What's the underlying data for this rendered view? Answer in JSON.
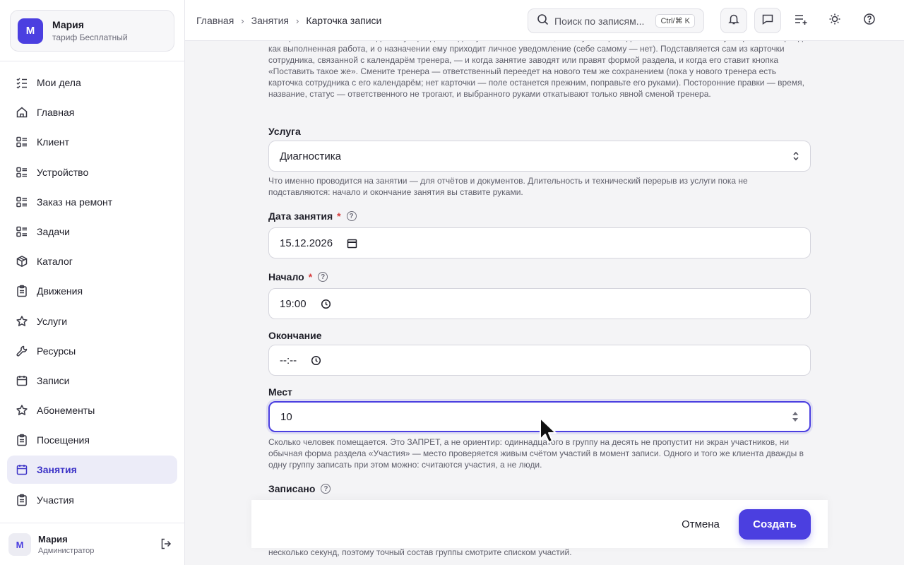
{
  "org": {
    "avatar": "М",
    "name": "Мария",
    "plan": "тариф Бесплатный"
  },
  "nav": [
    {
      "label": "Мои дела",
      "icon": "checklist-icon"
    },
    {
      "label": "Главная",
      "icon": "home-icon"
    },
    {
      "label": "Клиент",
      "icon": "list-icon"
    },
    {
      "label": "Устройство",
      "icon": "list-icon"
    },
    {
      "label": "Заказ на ремонт",
      "icon": "list-icon"
    },
    {
      "label": "Задачи",
      "icon": "list-icon"
    },
    {
      "label": "Каталог",
      "icon": "box-icon"
    },
    {
      "label": "Движения",
      "icon": "clipboard-icon"
    },
    {
      "label": "Услуги",
      "icon": "star-icon"
    },
    {
      "label": "Ресурсы",
      "icon": "wrench-icon"
    },
    {
      "label": "Записи",
      "icon": "calendar-icon"
    },
    {
      "label": "Абонементы",
      "icon": "star-icon"
    },
    {
      "label": "Посещения",
      "icon": "clipboard-icon"
    },
    {
      "label": "Занятия",
      "icon": "calendar-icon",
      "active": true
    },
    {
      "label": "Участия",
      "icon": "clipboard-icon"
    }
  ],
  "user": {
    "avatar": "М",
    "name": "Мария",
    "role": "Администратор"
  },
  "breadcrumb": {
    "home": "Главная",
    "section": "Занятия",
    "current": "Карточка записи"
  },
  "search": {
    "placeholder": "Поиск по записям...",
    "shortcut": "Ctrl/⌘ K"
  },
  "form": {
    "intro_help": "Кто провёл занятие: оно видно ему в разделе с доступом «только свои», в статусе «Проведено» засчитывается ему закрытием периода как выполненная работа, и о назначении ему приходит личное уведомление (себе самому — нет). Подставляется сам из карточки сотрудника, связанной с календарём тренера, — и когда занятие заводят или правят формой раздела, и когда его ставит кнопка «Поставить такое же». Смените тренера — ответственный переедет на нового тем же сохранением (пока у нового тренера есть карточка сотрудника с его календарём; нет карточки — поле останется прежним, поправьте его руками). Посторонние правки — время, название, статус — ответственного не трогают, и выбранного руками откатывают только явной сменой тренера.",
    "service_label": "Услуга",
    "service_value": "Диагностика",
    "service_help": "Что именно проводится на занятии — для отчётов и документов. Длительность и технический перерыв из услуги пока не подставляются: начало и окончание занятия вы ставите руками.",
    "date_label": "Дата занятия",
    "date_value": "15.12.2026",
    "start_label": "Начало",
    "start_value": "19:00",
    "end_label": "Окончание",
    "end_value": "--:--",
    "seats_label": "Мест",
    "seats_value": "10",
    "seats_help": "Сколько человек помещается. Это ЗАПРЕТ, а не ориентир: одиннадцатого в группу на десять не пропустит ни экран участников, ни обычная форма раздела «Участия» — место проверяется живым счётом участий в момент записи. Одного и того же клиента дважды в одну группу записать при этом можно: считаются участия, а не люди.",
    "enrolled_label": "Записано",
    "enrolled_help_tail": "несколько секунд, поэтому точный состав группы смотрите списком участий.",
    "required_mark": "*",
    "help_mark": "?"
  },
  "actions": {
    "cancel": "Отмена",
    "create": "Создать"
  },
  "colors": {
    "accent": "#4b3fe0",
    "required": "#d63b3b"
  }
}
